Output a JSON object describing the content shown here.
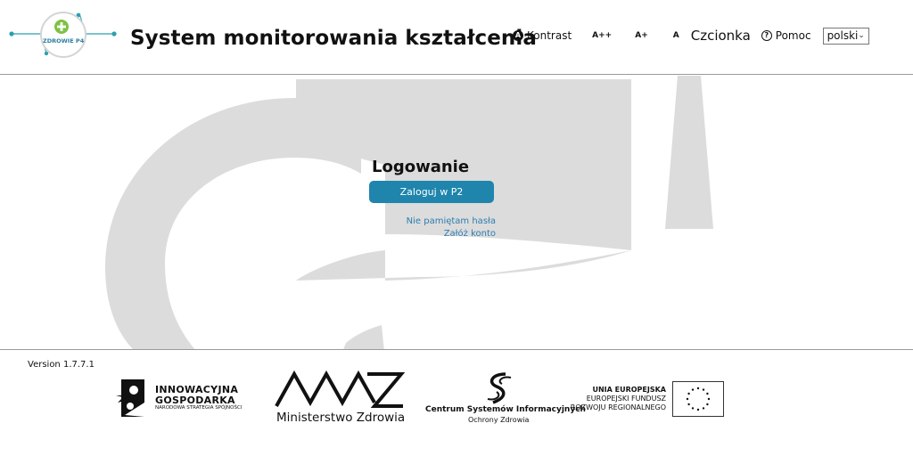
{
  "header": {
    "logo_text": "ZDROWIE P4",
    "title": "System monitorowania kształcenia",
    "toolbar": {
      "contrast_label": "Kontrast",
      "font_larger": "A++",
      "font_large": "A+",
      "font_normal": "A",
      "font_label": "Czcionka",
      "help_label": "Pomoc",
      "language_selected": "polski"
    }
  },
  "login": {
    "title": "Logowanie",
    "button_label": "Zaloguj w P2",
    "forgot_password": "Nie pamiętam hasła",
    "register": "Załóż konto"
  },
  "footer": {
    "version": "Version 1.7.7.1",
    "logos": {
      "ig_line1": "INNOWACYJNA",
      "ig_line2": "GOSPODARKA",
      "ig_sub": "NARODOWA STRATEGIA SPÓJNOŚCI",
      "mz_name": "Ministerstwo Zdrowia",
      "csioz_main": "Centrum Systemów Informacyjnych",
      "csioz_sub": "Ochrony Zdrowia",
      "eu_line1": "UNIA EUROPEJSKA",
      "eu_line2": "EUROPEJSKI FUNDUSZ",
      "eu_line3": "ROZWOJU REGIONALNEGO"
    }
  },
  "colors": {
    "accent": "#1f85ad",
    "link": "#2c7db0",
    "logo_teal": "#2aa0b0",
    "logo_green": "#7dc242",
    "watermark": "#dcdcdc"
  }
}
